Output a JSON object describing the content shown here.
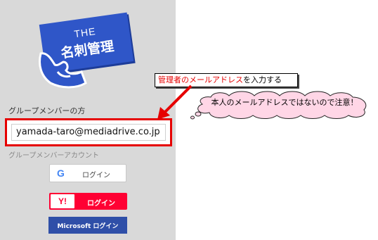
{
  "logo": {
    "line1": "THE",
    "line2": "名刺管理"
  },
  "form": {
    "group_label": "グループメンバーの方",
    "email_value": "yamada-taro@mediadrive.co.jp",
    "account_label": "グループメンバーアカウント"
  },
  "buttons": {
    "google_label": "ログイン",
    "yahoo_icon": "Y!",
    "yahoo_label": "ログイン",
    "microsoft_label": "Microsoft ログイン"
  },
  "annotations": {
    "callout_red": "管理者のメールアドレス",
    "callout_black": "を入力する",
    "cloud_note": "本人のメールアドレスではないので注意！"
  },
  "colors": {
    "panel_bg": "#d9d9d9",
    "highlight_red": "#e60000",
    "yahoo_red": "#ff0033",
    "microsoft_blue": "#2f4fa8",
    "logo_blue": "#2f56c8",
    "cloud_fill": "#ffd6e6"
  }
}
